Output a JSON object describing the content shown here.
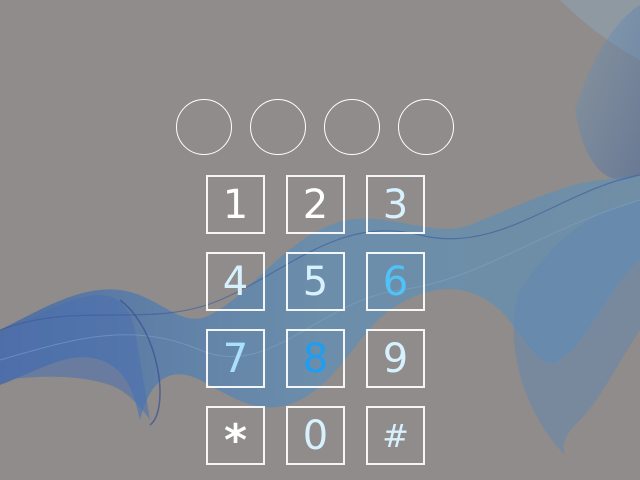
{
  "lock_screen": {
    "pin_dots": [
      {
        "filled": false
      },
      {
        "filled": false
      },
      {
        "filled": false
      },
      {
        "filled": false
      }
    ],
    "keypad": {
      "k1": "1",
      "k2": "2",
      "k3": "3",
      "k4": "4",
      "k5": "5",
      "k6": "6",
      "k7": "7",
      "k8": "8",
      "k9": "9",
      "kstar": "*",
      "k0": "0",
      "khash": "#"
    }
  },
  "colors": {
    "background": "#8f8c8b",
    "wave_blue": "#3f6fae",
    "key_border": "#ffffff",
    "digit_white": "#ffffff",
    "digit_cyan": "#4fc3f7",
    "digit_blue": "#1e9ef0"
  }
}
